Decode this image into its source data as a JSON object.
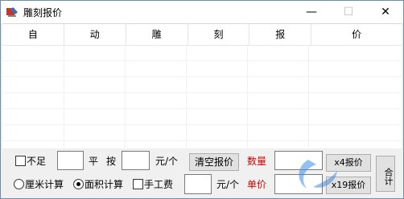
{
  "window": {
    "title": "雕刻报价",
    "minimize_glyph": "—",
    "maximize_glyph": "☐",
    "close_glyph": "✕"
  },
  "grid": {
    "columns": [
      "自",
      "动",
      "雕",
      "刻",
      "报",
      "价"
    ]
  },
  "controls": {
    "shortfall_label": "不足",
    "ping_label": "平",
    "by_label": "按",
    "unit_price_per_piece_label": "元/个",
    "clear_button": "清空报价",
    "quantity_label": "数量",
    "x4_button": "x4报价",
    "total_button": "合计",
    "cm_calc_label": "厘米计算",
    "area_calc_label": "面积计算",
    "handling_fee_label": "手工费",
    "fee_unit_label": "元/个",
    "unit_price_label": "单价",
    "x19_button": "x19报价"
  },
  "colors": {
    "accent_red": "#d40000"
  },
  "selected_mode": "面积计算"
}
